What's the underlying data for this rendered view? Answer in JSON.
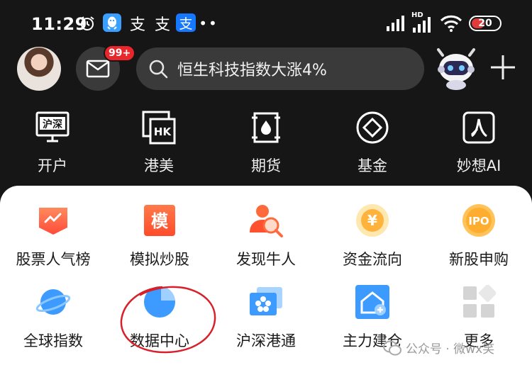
{
  "status_bar": {
    "time": "11:29",
    "zhi_glyph": "支",
    "dots": "••",
    "hd_label": "HD",
    "battery": "20"
  },
  "header": {
    "message_badge": "99+",
    "search_text": "恒生科技指数大涨4%"
  },
  "quick_nav": [
    {
      "label": "开户",
      "icon": "shanghai-shenzhen-screen-icon",
      "icon_text": "沪深"
    },
    {
      "label": "港美",
      "icon": "hk-us-icon",
      "icon_text": "HK"
    },
    {
      "label": "期货",
      "icon": "futures-drop-icon"
    },
    {
      "label": "基金",
      "icon": "fund-diamond-icon"
    },
    {
      "label": "妙想AI",
      "icon": "ai-icon"
    }
  ],
  "grid": [
    {
      "label": "股票人气榜",
      "icon": "popularity-chart-icon"
    },
    {
      "label": "模拟炒股",
      "icon": "simulated-trading-icon",
      "icon_text": "模"
    },
    {
      "label": "发现牛人",
      "icon": "discover-expert-icon"
    },
    {
      "label": "资金流向",
      "icon": "capital-flow-icon",
      "icon_text": "¥"
    },
    {
      "label": "新股申购",
      "icon": "ipo-icon",
      "icon_text": "IPO"
    },
    {
      "label": "全球指数",
      "icon": "global-index-planet-icon"
    },
    {
      "label": "数据中心",
      "icon": "data-center-pie-icon"
    },
    {
      "label": "沪深港通",
      "icon": "connect-hk-flower-icon"
    },
    {
      "label": "主力建仓",
      "icon": "main-force-house-icon"
    },
    {
      "label": "更多",
      "icon": "more-grid-icon"
    }
  ],
  "watermark": "公众号 · 微wx笑",
  "colors": {
    "background": "#161616",
    "panel": "#ffffff",
    "badge": "#e8262b",
    "accent_orange": "#ff5a2e",
    "accent_blue": "#3d9bff",
    "annotation": "#d8202a"
  }
}
